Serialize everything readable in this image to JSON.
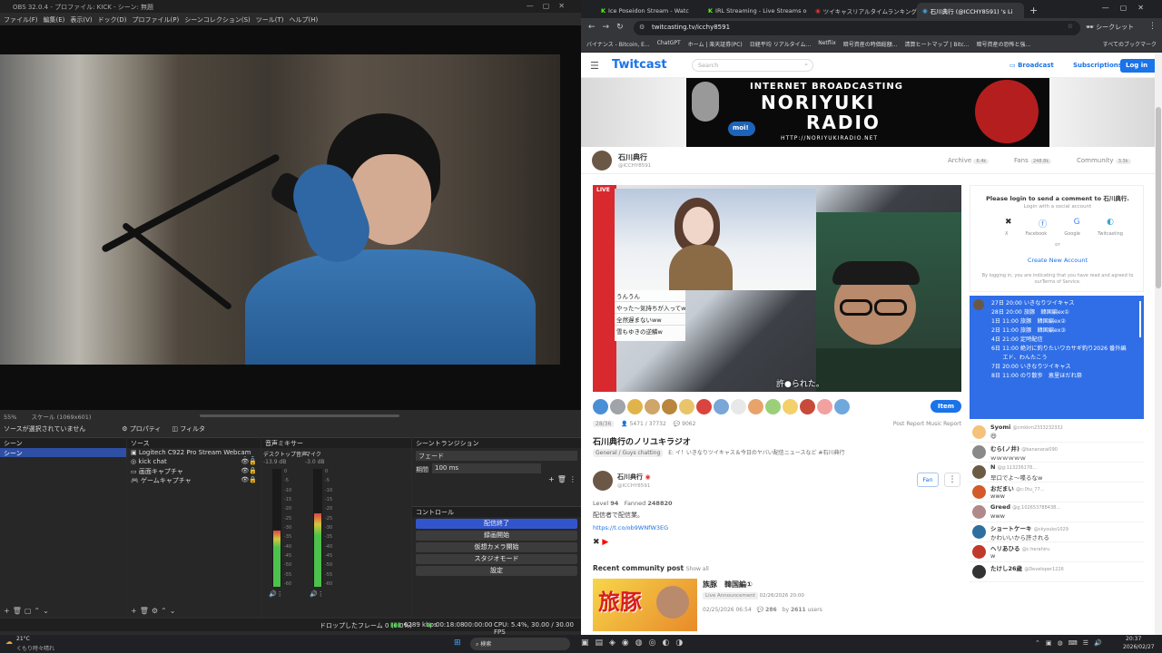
{
  "obs": {
    "title": "OBS 32.0.4 - プロファイル: KICK - シーン: 無題",
    "menu": [
      "ファイル(F)",
      "編集(E)",
      "表示(V)",
      "ドック(D)",
      "プロファイル(P)",
      "シーンコレクション(S)",
      "ツール(T)",
      "ヘルプ(H)"
    ],
    "zoom": "55%",
    "scale": "スケール (1069x601)",
    "no_source": "ソースが選択されていません",
    "properties": "プロパティ",
    "filters": "フィルタ",
    "scenes_header": "シーン",
    "scene_item": "シーン",
    "sources_header": "ソース",
    "sources": [
      "Logitech C922 Pro Stream Webcam",
      "kick chat",
      "画面キャプチャ",
      "ゲームキャプチャ"
    ],
    "mixer_header": "音声ミキサー",
    "mixer_ch1": "デスクトップ音声",
    "mixer_ch2": "マイク",
    "mixer_db1": "-13.9 dB",
    "mixer_db2": "-3.0 dB",
    "mixer_ticks": [
      "0",
      "-5",
      "-10",
      "-15",
      "-20",
      "-25",
      "-30",
      "-35",
      "-40",
      "-45",
      "-50",
      "-55",
      "-60"
    ],
    "mixer_levels": {
      "ch1_fill": 0.48,
      "ch2_fill": 0.62
    },
    "transition_header": "シーントランジション",
    "transition": "フェード",
    "duration_label": "期間",
    "duration": "100 ms",
    "controls_header": "コントロール",
    "controls": [
      "配信終了",
      "録画開始",
      "仮想カメラ開始",
      "スタジオモード",
      "設定"
    ],
    "status": {
      "dropped": "ドロップしたフレーム 0 (0.0%)",
      "bitrate": "6289 kbps",
      "live": "00:18:08",
      "rec": "00:00:00",
      "cpu": "CPU: 5.4%, 30.00 / 30.00 FPS"
    }
  },
  "browser": {
    "tabs": [
      "Ice Poseidon Stream - Watc",
      "IRL Streaming - Live Streams o",
      "ツイキャスリアルタイムランキング | 記",
      "石川典行 (@ICCHY8591) 's Li"
    ],
    "url": "twitcasting.tv/icchy8591",
    "incognito": "シークレット",
    "bookmarks": [
      "バイナンス - Bitcoin, E...",
      "ChatGPT",
      "ホーム | 楽天証券(PC)",
      "日経平均 リアルタイム...",
      "Netflix",
      "暗号資産の時価総額...",
      "清算ヒートマップ | Bitc...",
      "暗号資産の恐怖と強...",
      "すべてのブックマーク"
    ]
  },
  "site": {
    "logo": "Twitcast",
    "search_placeholder": "Search",
    "broadcast": "Broadcast",
    "subscriptions": "Subscriptions",
    "login": "Log in",
    "banner_top": "INTERNET BROADCASTING",
    "banner_main1": "NORIYUKI",
    "banner_main2": "RADIO",
    "banner_url": "HTTP://NORIYUKIRADIO.NET",
    "banner_moi": "moi!",
    "user_name": "石川典行",
    "user_id": "@ICCHY8591",
    "nav": [
      {
        "label": "Archive",
        "badge": "6.4k"
      },
      {
        "label": "Fans",
        "badge": "248.8k"
      },
      {
        "label": "Community",
        "badge": "3.3k"
      }
    ],
    "live_badge": "LIVE",
    "overlay_lines": [
      "うんうん",
      "やった〜気持ちが入ってw",
      "全然遅まないww",
      "雪もゆきの逆鱗w"
    ],
    "subtitle": "許●られた。",
    "item_button": "Item",
    "viewers": "28/36",
    "total_views": "5471 / 37732",
    "comments_count": "9062",
    "actions": [
      "Post",
      "Report",
      "Music Report"
    ],
    "stream_title": "石川典行のノリユキラジオ",
    "tag": "General / Guys chatting",
    "notice": "E: イ！いきなりツイキャス＆今日のヤバい配信ニュースなど #石川典行",
    "profile_name": "石川典行",
    "profile_id": "@ICCHY8591",
    "level_label": "Level",
    "level": "94",
    "fanned_label": "Fanned",
    "fanned": "248820",
    "profile_desc": "配信者で配信業。",
    "profile_link": "https://t.co/ob9WNfW3EG",
    "fan_button": "Fan",
    "community_header": "Recent community post",
    "show_all": "Show all",
    "post_title": "族豚　韓国編①",
    "post_badge": "Live Announcement",
    "post_date": "02/26/2026 20:00",
    "post_time": "02/25/2026 06:54",
    "post_comments": "286",
    "post_users_pre": "by",
    "post_users": "2611",
    "post_users_suffix": "users",
    "post_thumb_text": "旅豚",
    "login_prompt": "Please login to send a comment to 石川典行.",
    "login_social": "Login with a social account",
    "social": [
      "X",
      "Facebook",
      "Google",
      "Twitcasting"
    ],
    "or": "or",
    "create_account": "Create New Account",
    "terms": "By logging in, you are indicating that you have read and agreed to ourTerms of Service.",
    "schedule": [
      "27日 20:00 いきなりツイキャス",
      "28日 20:00 旅豚　韓国編ex①",
      "1日 11:00 旅豚　韓国編ex②",
      "2日 11:00 旅豚　韓国編ex③",
      "4日 21:00 定時配信",
      "6日 11:00 絶対に釣りたいワカサギ釣り2026 番外編",
      "　　エド、わんたこう",
      "7日 20:00 いきなりツイキャス",
      "8日 11:00 のり散歩　恵里ほだれ祭"
    ],
    "chat": [
      {
        "name": "Syomi",
        "id": "@cmkkm2333232332",
        "msg": "😄",
        "color": "#f4c27a"
      },
      {
        "name": "むら(ノ井)",
        "id": "@bananarai090",
        "msg": "ｗｗｗｗｗｗ",
        "color": "#8a8a8a"
      },
      {
        "name": "N",
        "id": "@g:113236178...",
        "msg": "早口でよ〜喋るなw",
        "color": "#6b5b45"
      },
      {
        "name": "おだまい",
        "id": "@c:0tu_77...",
        "msg": "www",
        "color": "#d45a2a"
      },
      {
        "name": "Greed",
        "id": "@g:102653788438...",
        "msg": "www",
        "color": "#b08a8a"
      },
      {
        "name": "ショートケーキ",
        "id": "@ckyouko1029",
        "msg": "かわいいから許される",
        "color": "#2f6f9f"
      },
      {
        "name": "ヘリあひる",
        "id": "@c:herahiru",
        "msg": "w",
        "color": "#c0392b"
      },
      {
        "name": "たけし26歳",
        "id": "@Developer1226",
        "msg": "",
        "color": "#333"
      }
    ]
  },
  "taskbar": {
    "weather_temp": "21°C",
    "weather_desc": "くもり時々晴れ",
    "search": "検索",
    "time": "20:37",
    "date": "2026/02/27"
  }
}
